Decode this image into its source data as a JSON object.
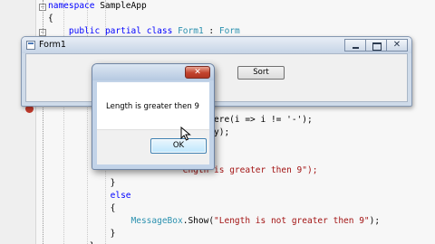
{
  "editor": {
    "code_lines": [
      [
        {
          "t": "namespace",
          "c": "kw"
        },
        {
          "t": " SampleApp",
          "c": ""
        }
      ],
      [
        {
          "t": "{",
          "c": ""
        }
      ],
      [
        {
          "t": "    ",
          "c": ""
        },
        {
          "t": "public",
          "c": "kw"
        },
        {
          "t": " ",
          "c": ""
        },
        {
          "t": "partial",
          "c": "kw"
        },
        {
          "t": " ",
          "c": ""
        },
        {
          "t": "class",
          "c": "kw"
        },
        {
          "t": " ",
          "c": ""
        },
        {
          "t": "Form1",
          "c": "ty"
        },
        {
          "t": " : ",
          "c": ""
        },
        {
          "t": "Form",
          "c": "ty"
        }
      ],
      [
        {
          "t": "    {",
          "c": ""
        }
      ],
      [
        {
          "t": "",
          "c": ""
        }
      ],
      [
        {
          "t": "",
          "c": ""
        }
      ],
      [
        {
          "t": "",
          "c": ""
        }
      ],
      [
        {
          "t": "",
          "c": ""
        }
      ],
      [
        {
          "t": "",
          "c": ""
        }
      ],
      [
        {
          "t": "                          ext.Where(i => i != '-');",
          "c": ""
        }
      ],
      [
        {
          "t": "                          trarray);",
          "c": ""
        }
      ],
      [
        {
          "t": "",
          "c": ""
        }
      ],
      [
        {
          "t": "",
          "c": ""
        }
      ],
      [
        {
          "t": "                          ",
          "c": ""
        },
        {
          "t": "ength is greater then 9\");",
          "c": "str"
        }
      ],
      [
        {
          "t": "            }",
          "c": ""
        }
      ],
      [
        {
          "t": "            ",
          "c": ""
        },
        {
          "t": "else",
          "c": "kw"
        }
      ],
      [
        {
          "t": "            {",
          "c": ""
        }
      ],
      [
        {
          "t": "                ",
          "c": ""
        },
        {
          "t": "MessageBox",
          "c": "ty"
        },
        {
          "t": ".Show(",
          "c": ""
        },
        {
          "t": "\"Length is not greater then 9\"",
          "c": "str"
        },
        {
          "t": ");",
          "c": ""
        }
      ],
      [
        {
          "t": "            }",
          "c": ""
        }
      ],
      [
        {
          "t": "        }",
          "c": ""
        }
      ]
    ]
  },
  "form_window": {
    "title": "Form1",
    "icon": "form-app-icon",
    "buttons": {
      "minimize": "minimize-icon",
      "maximize": "maximize-icon",
      "close_glyph": "✕"
    },
    "sort_button_label": "Sort"
  },
  "message_box": {
    "message": "Length is greater then 9",
    "ok_label": "OK",
    "close_glyph": "✕"
  },
  "colors": {
    "keyword": "#0000ff",
    "type": "#2b91af",
    "string": "#a31515",
    "close_button": "#c2432e"
  }
}
